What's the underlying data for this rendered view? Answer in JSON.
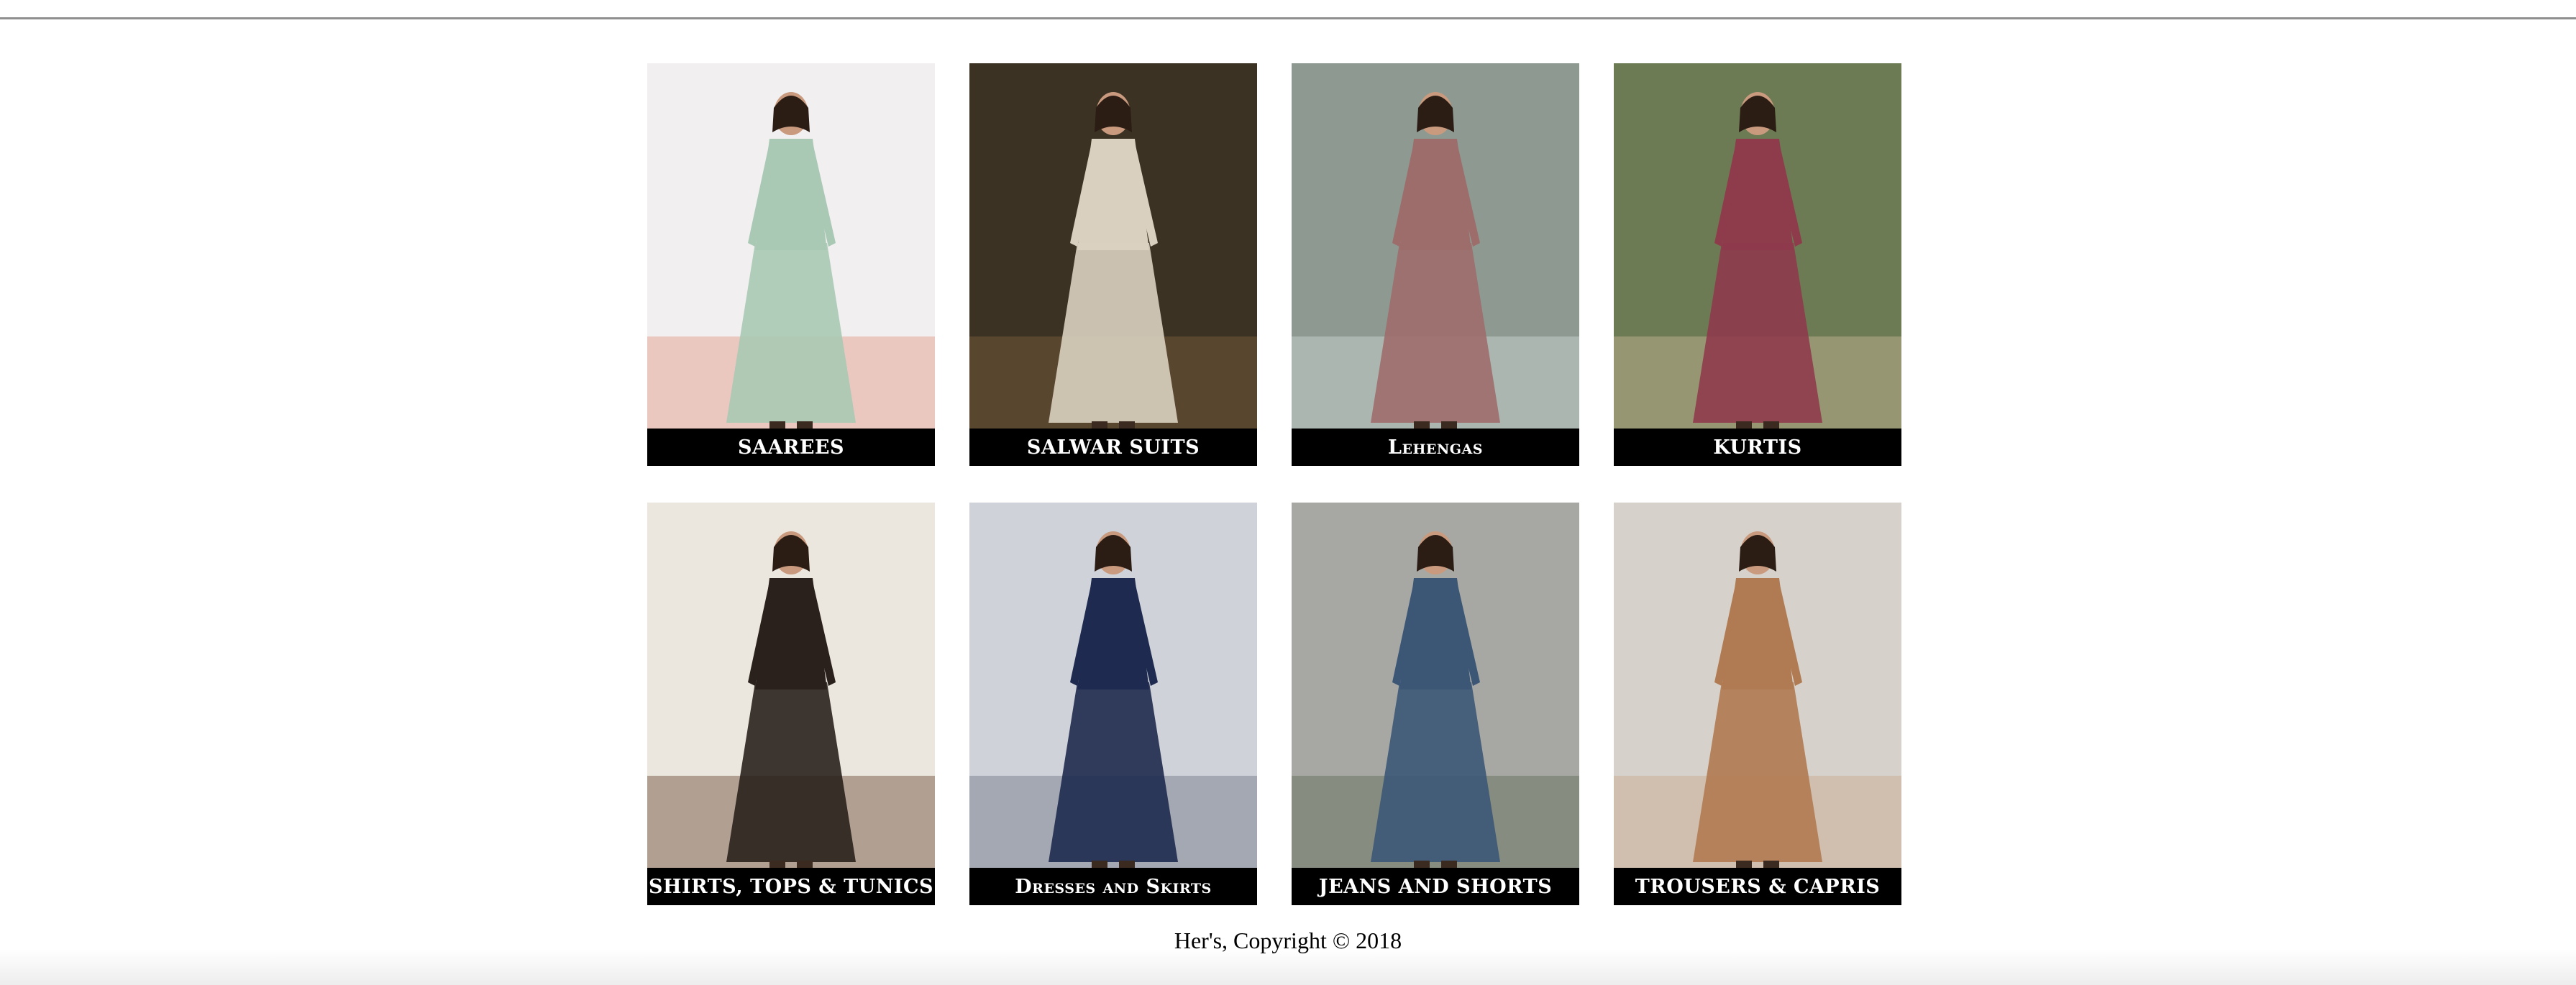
{
  "categories": [
    {
      "label": "SAAREES",
      "icon": "saree-photo",
      "bg": "#f1eff0",
      "accent": "#e39a83",
      "garment": "#a9c9b4"
    },
    {
      "label": "SALWAR SUITS",
      "icon": "salwar-suit-photo",
      "bg": "#3c3224",
      "accent": "#7a5f3e",
      "garment": "#d9d0c0"
    },
    {
      "label": "Lehengas",
      "icon": "lehenga-photo",
      "bg": "#8e9a91",
      "accent": "#cfd9d8",
      "garment": "#9d6d6b"
    },
    {
      "label": "KURTIS",
      "icon": "kurti-photo",
      "bg": "#6c7b53",
      "accent": "#c9b79a",
      "garment": "#8e3b4c"
    },
    {
      "label": "SHIRTS, TOPS & TUNICS",
      "icon": "shirts-tops-photo",
      "bg": "#ece7de",
      "accent": "#6a4a35",
      "garment": "#2a211d"
    },
    {
      "label": "Dresses and Skirts",
      "icon": "dress-photo",
      "bg": "#cfd2d8",
      "accent": "#6f7585",
      "garment": "#1e2a4f"
    },
    {
      "label": "JEANS AND SHORTS",
      "icon": "jeans-photo",
      "bg": "#a7a8a3",
      "accent": "#5f6b56",
      "garment": "#3c5676"
    },
    {
      "label": "TROUSERS & CAPRIS",
      "icon": "trousers-photo",
      "bg": "#d6d2cb",
      "accent": "#c9a98f",
      "garment": "#b07a52"
    }
  ],
  "footer": {
    "text": "Her's, Copyright © 2018"
  }
}
